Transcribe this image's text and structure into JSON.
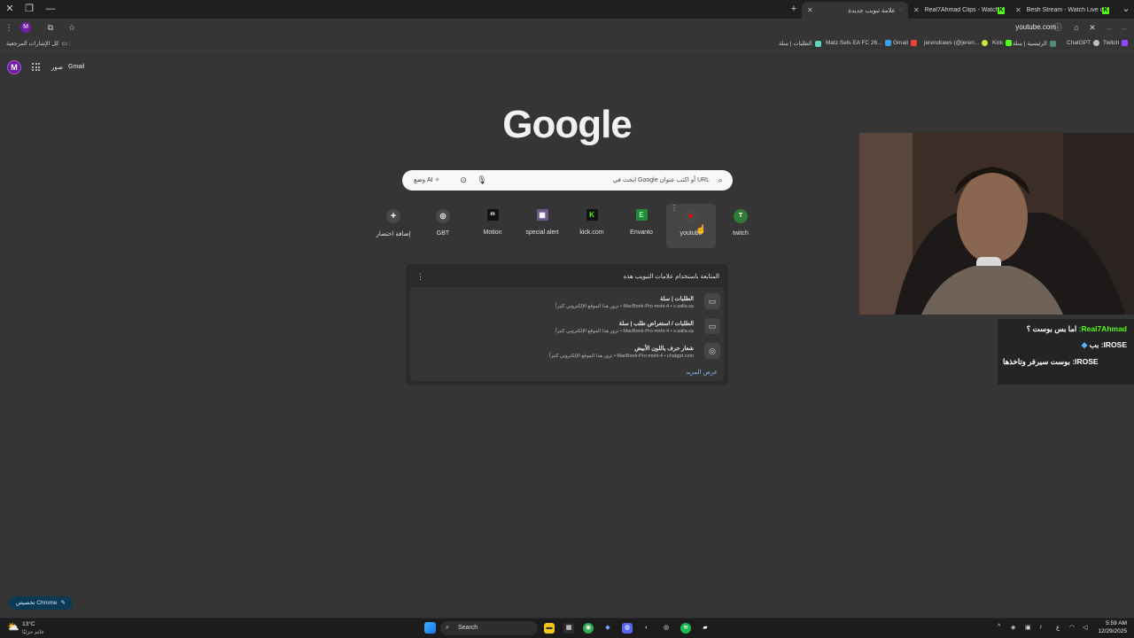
{
  "tabs": [
    {
      "title": "علامة تبويب جديدة",
      "active": true
    },
    {
      "title": "Real7Ahmad Clips - Watch Live"
    },
    {
      "title": "Besh Stream - Watch Live on Ki"
    }
  ],
  "toolbar": {
    "url": "youtube.com"
  },
  "bookmarks": {
    "all_bookmarks": "كل الإشارات المرجعية",
    "items": [
      {
        "label": "Twitch",
        "color": "#9146ff"
      },
      {
        "label": "ChatGPT",
        "color": "#bdbdbd"
      },
      {
        "label": "الرئيسية | سلة",
        "color": "#53fc18"
      },
      {
        "label": "Kick",
        "color": "#53fc18"
      },
      {
        "label": "jerendraws (@jeren...",
        "color": "#c7e83a"
      },
      {
        "label": "Gmail",
        "color": "#ea4335"
      },
      {
        "label": "Matz Sels EA FC 26...",
        "color": "#3aa0e8"
      },
      {
        "label": "الطلبات | سلة",
        "color": "#5fd3c0"
      }
    ]
  },
  "ntp": {
    "avatar_letter": "M",
    "gmail": "Gmail",
    "images": "صور",
    "logo": "Google",
    "search_placeholder": "ابحث في Google أو اكتب عنوان URL",
    "ai_mode": "وضع AI"
  },
  "shortcuts": [
    {
      "label": "إضافة اختصار",
      "icon": "+",
      "color": "#4a4a4a"
    },
    {
      "label": "GBT",
      "icon": "◎",
      "color": "#4a4a4a"
    },
    {
      "label": "Motion",
      "icon": "m",
      "color": "#111111"
    },
    {
      "label": "special alert",
      "icon": "▦",
      "color": "#6d5a8a"
    },
    {
      "label": "kick.com",
      "icon": "K",
      "color": "#111111"
    },
    {
      "label": "Envanto",
      "icon": "E",
      "color": "#1e8c3a"
    },
    {
      "label": "youtube",
      "icon": "▶",
      "color": "#ff0000"
    },
    {
      "label": "twitch",
      "icon": "T",
      "color": "#2e7d32"
    }
  ],
  "journeys": {
    "title": "المتابعة باستخدام علامات التبويب هذه",
    "items": [
      {
        "title": "الطلبات | سلة",
        "sub": "تزور هذا الموقع الإلكتروني كثيراً • MacBook-Pro-mshi-4 • s.salla.sa"
      },
      {
        "title": "الطلبات / استعراض طلب | سلة",
        "sub": "تزور هذا الموقع الإلكتروني كثيراً • MacBook-Pro-mshi-4 • s.salla.sa"
      },
      {
        "title": "شعار حرف ياللون الأبيض",
        "sub": "تزور هذا الموقع الإلكتروني كثيراً • MacBook-Pro-mshi-4 • chatgpt.com"
      }
    ],
    "show_more": "عرض المزيد"
  },
  "chat": [
    {
      "name": "Real7Ahmad:",
      "msg": "اما بس بوست ؟"
    },
    {
      "name": "IROSE:",
      "msg": "بب"
    },
    {
      "name": "IROSE:",
      "msg": "بوست سيرفر وتاخذها"
    }
  ],
  "customize": "تخصيص Chrome",
  "taskbar": {
    "weather_temp": "13°C",
    "weather_desc": "غائم جزئيًا",
    "search": "Search",
    "time": "5:59 AM",
    "date": "12/29/2025"
  }
}
